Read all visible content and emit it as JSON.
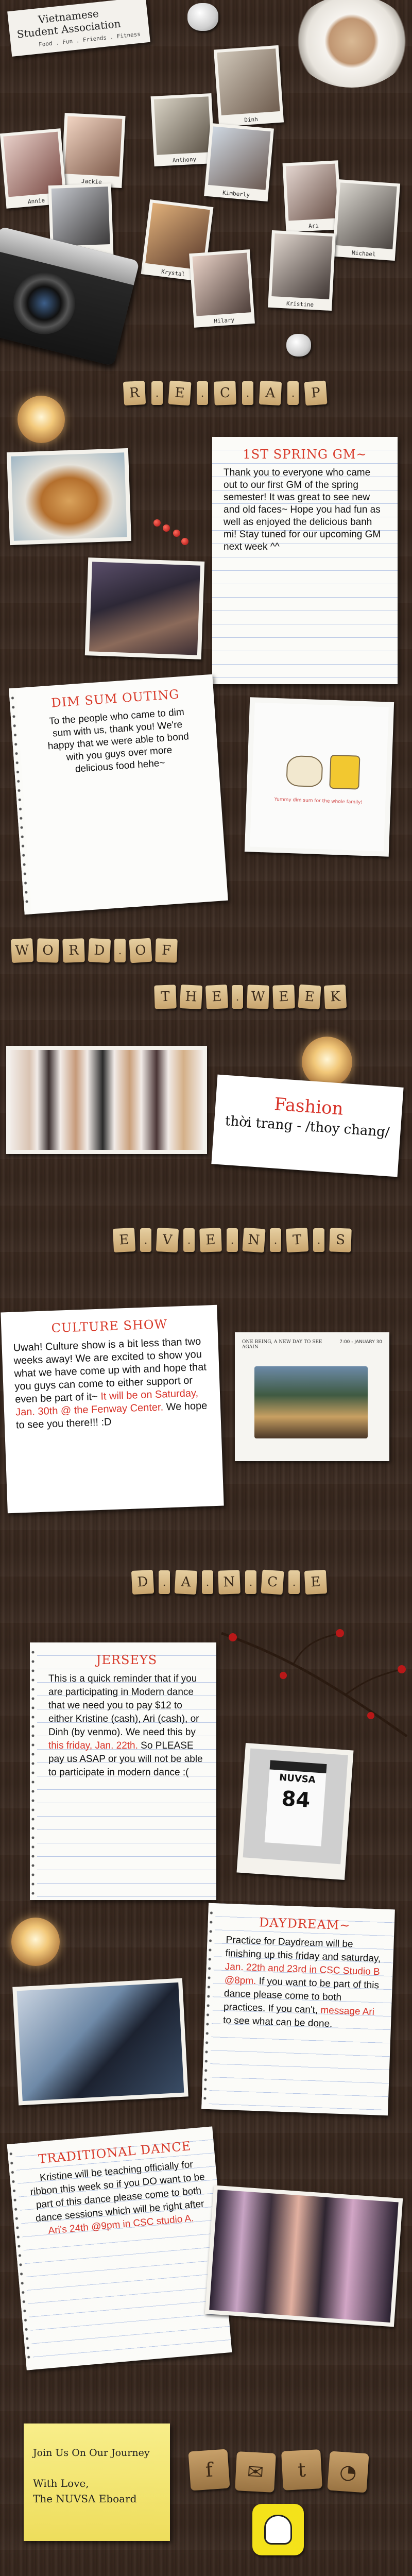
{
  "header": {
    "title_line1": "Vietnamese",
    "title_line2": "Student Association",
    "tagline": "Food . Fun . Friends . Fitness"
  },
  "board_members": [
    {
      "name": "Dinh"
    },
    {
      "name": "Jackie"
    },
    {
      "name": "Anthony"
    },
    {
      "name": "Kimberly"
    },
    {
      "name": "Annie"
    },
    {
      "name": "Matt"
    },
    {
      "name": "Krystal"
    },
    {
      "name": "Ari"
    },
    {
      "name": "Michael"
    },
    {
      "name": "Hilary"
    },
    {
      "name": "Kristine"
    }
  ],
  "recap": {
    "tiles": [
      "R",
      "E",
      "C",
      "A",
      "P"
    ],
    "gm": {
      "title": "1ST SPRING GM~",
      "body": "Thank you to everyone who came out to our first GM of the spring semester! It was great to see new and old faces~ Hope you had fun as well as enjoyed the delicious banh mi! Stay tuned for our upcoming GM next week ^^"
    },
    "dimsum": {
      "title": "DIM SUM OUTING",
      "body": "To the people who came to dim sum with us, thank you! We're happy that we were able to bond with you guys over more delicious food hehe~"
    },
    "photo_caption": "Yummy dim sum for the whole family!"
  },
  "word_of_week": {
    "tiles_line1": [
      "W",
      "O",
      "R",
      "D",
      "O",
      "F"
    ],
    "tiles_line2": [
      "T",
      "H",
      "E",
      "W",
      "E",
      "E",
      "K"
    ],
    "word": "Fashion",
    "translation": "thời trang - /thoy chang/"
  },
  "events": {
    "tiles": [
      "E",
      "V",
      "E",
      "N",
      "T",
      "S"
    ],
    "culture": {
      "title": "CULTURE SHOW",
      "body_a": "Uwah! Culture show is a bit less than two weeks away! We are excited to show you what we have come up with and hope that you guys can come to either support or even be part of it~ ",
      "body_red": "It will be on Saturday, Jan. 30th @ the Fenway Center.",
      "body_b": " We hope to see you there!!! :D"
    },
    "poster_title": "ONE BEING, A NEW DAY TO SEE AGAIN",
    "poster_date": "7:00 - JANUARY 30"
  },
  "dance": {
    "tiles": [
      "D",
      "A",
      "N",
      "C",
      "E"
    ],
    "jerseys": {
      "title": "JERSEYS",
      "body_a": "This is a quick reminder that if you are participating in Modern dance that we need you to pay $12 to either Kristine (cash), Ari (cash), or Dinh (by venmo). We need this by ",
      "body_red": "this friday, Jan. 22th.",
      "body_b": " So PLEASE pay us ASAP or you will not be able to participate in modern dance :("
    },
    "jersey_name": "NUVSA",
    "jersey_number": "84",
    "daydream": {
      "title": "DAYDREAM~",
      "body_a": "Practice for Daydream will be finishing up this friday and saturday, ",
      "body_red": "Jan. 22th and 23rd in CSC Studio B @8pm.",
      "body_b": " If you want to be part of this dance please come to both practices. If you can't, ",
      "body_red2": "message Ari",
      "body_c": " to see what can be done."
    },
    "traditional": {
      "title": "TRADITIONAL DANCE",
      "body_a": "Kristine will be teaching officially for ribbon this week so if you DO want to be part of this dance please come to both dance sessions which will be right after ",
      "body_red": "Ari's 24th @9pm in CSC studio A."
    }
  },
  "footer": {
    "line1": "Join Us On Our Journey",
    "line2": "With Love,",
    "line3": "The NUVSA Eboard",
    "social": [
      {
        "icon": "facebook-icon",
        "glyph": "f"
      },
      {
        "icon": "email-icon",
        "glyph": "✉"
      },
      {
        "icon": "twitter-icon",
        "glyph": "t"
      },
      {
        "icon": "rss-icon",
        "glyph": "◔"
      }
    ]
  }
}
